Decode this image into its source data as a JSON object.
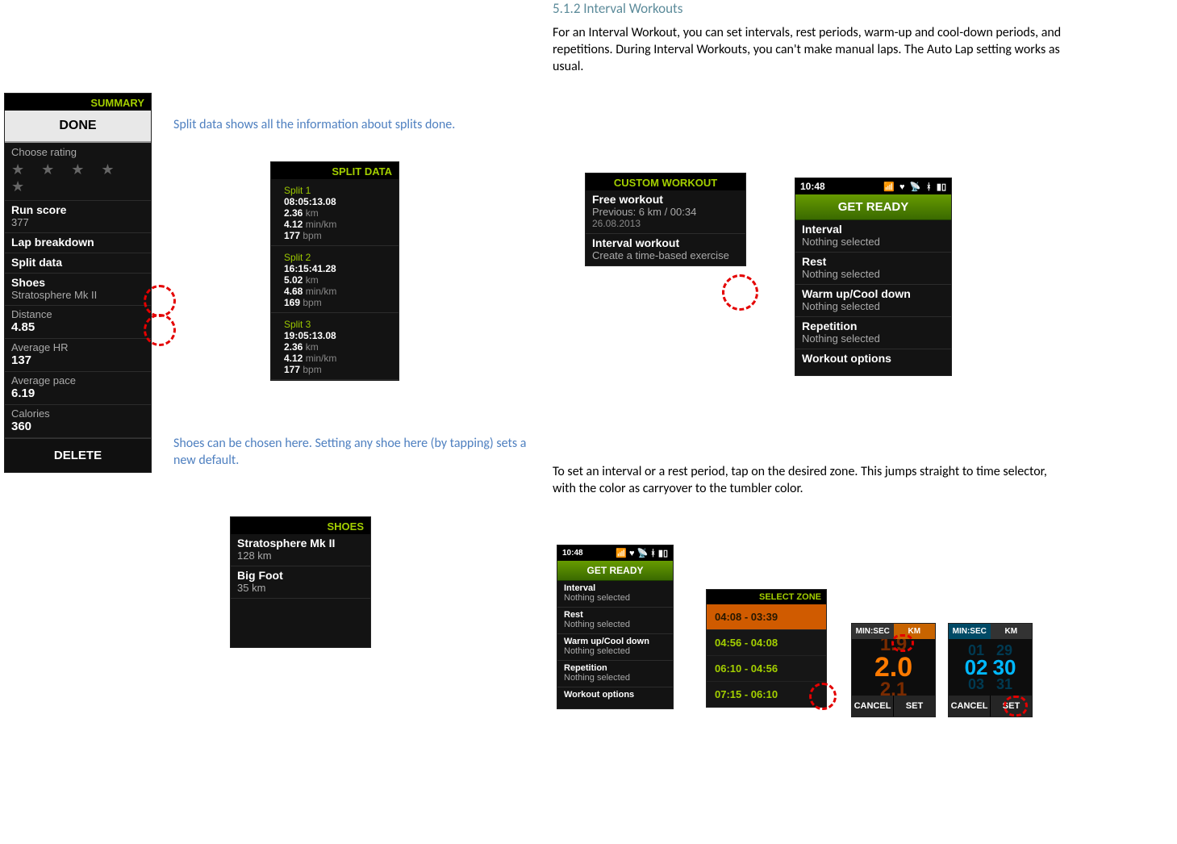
{
  "heading": "5.1.2 Interval Workouts",
  "intro_para": "For an Interval Workout, you can set intervals, rest periods, warm-up and cool-down periods, and repetitions. During Interval Workouts, you can't make manual laps. The Auto Lap setting works as usual.",
  "caption_split": "Split data shows all the information about splits done.",
  "caption_shoes": "Shoes can be chosen here. Setting any shoe here (by tapping) sets a new default.",
  "para_tap": "To set an interval or a rest period, tap on the desired zone. This jumps straight to time selector, with the color as carryover to the tumbler color.",
  "summary_panel": {
    "header": "SUMMARY",
    "done": "DONE",
    "choose_rating": "Choose rating",
    "run_score_label": "Run score",
    "run_score_value": "377",
    "lap_breakdown": "Lap breakdown",
    "split_data": "Split data",
    "shoes_label": "Shoes",
    "shoes_value": "Stratosphere Mk II",
    "distance_label": "Distance",
    "distance_value": "4.85",
    "avg_hr_label": "Average HR",
    "avg_hr_value": "137",
    "avg_pace_label": "Average pace",
    "avg_pace_value": "6.19",
    "calories_label": "Calories",
    "calories_value": "360",
    "delete": "DELETE"
  },
  "splitdata_panel": {
    "header": "SPLIT DATA",
    "splits": [
      {
        "name": "Split 1",
        "time": "08:05:13.08",
        "dist": "2.36",
        "dist_unit": "km",
        "pace": "4.12",
        "pace_unit": "min/km",
        "hr": "177",
        "hr_unit": "bpm"
      },
      {
        "name": "Split 2",
        "time": "16:15:41.28",
        "dist": "5.02",
        "dist_unit": "km",
        "pace": "4.68",
        "pace_unit": "min/km",
        "hr": "169",
        "hr_unit": "bpm"
      },
      {
        "name": "Split 3",
        "time": "19:05:13.08",
        "dist": "2.36",
        "dist_unit": "km",
        "pace": "4.12",
        "pace_unit": "min/km",
        "hr": "177",
        "hr_unit": "bpm"
      }
    ]
  },
  "shoes_panel": {
    "header": "SHOES",
    "items": [
      {
        "name": "Stratosphere Mk II",
        "km": "128 km"
      },
      {
        "name": "Big Foot",
        "km": "35 km"
      }
    ]
  },
  "custom_panel": {
    "header": "CUSTOM WORKOUT",
    "free_title": "Free workout",
    "free_sub": "Previous: 6 km / 00:34",
    "free_date": "26.08.2013",
    "interval_title": "Interval workout",
    "interval_sub": "Create a time-based exercise"
  },
  "getready_panel": {
    "time": "10:48",
    "getready": "GET READY",
    "rows": [
      {
        "title": "Interval",
        "sub": "Nothing selected"
      },
      {
        "title": "Rest",
        "sub": "Nothing selected"
      },
      {
        "title": "Warm up/Cool down",
        "sub": "Nothing selected"
      },
      {
        "title": "Repetition",
        "sub": "Nothing selected"
      }
    ],
    "options": "Workout options"
  },
  "zone_panel": {
    "header": "SELECT ZONE",
    "rows": [
      "04:08 - 03:39",
      "04:56 - 04:08",
      "06:10 - 04:56",
      "07:15 - 06:10"
    ]
  },
  "tumbler1": {
    "tab1": "MIN:SEC",
    "tab2": "KM",
    "main": "2.0",
    "btn_cancel": "CANCEL",
    "btn_set": "SET"
  },
  "tumbler2": {
    "tab1": "MIN:SEC",
    "tab2": "KM",
    "main_l": "02",
    "main_r": "30",
    "btn_cancel": "CANCEL",
    "btn_set": "SET"
  }
}
